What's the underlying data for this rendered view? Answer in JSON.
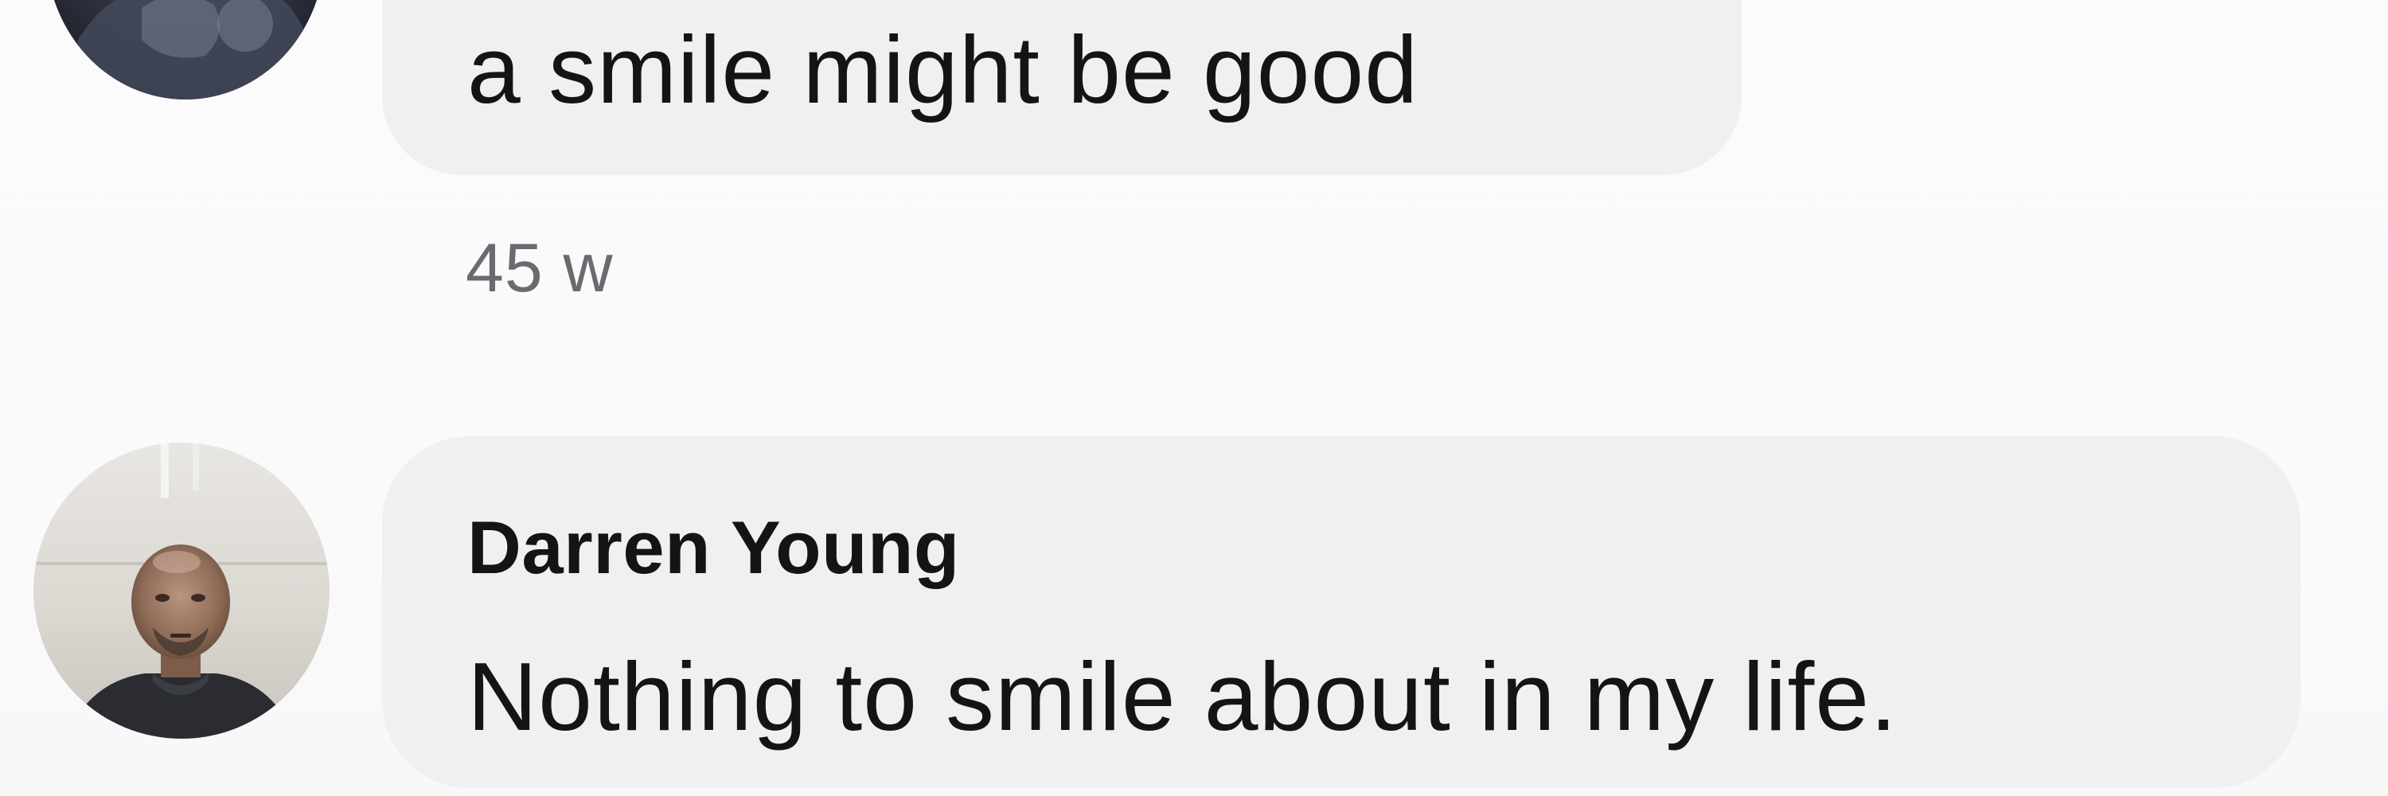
{
  "comments": [
    {
      "text": "a smile might be good",
      "time": "45 w"
    },
    {
      "author": "Darren Young",
      "text": "Nothing to smile about in my life."
    }
  ]
}
